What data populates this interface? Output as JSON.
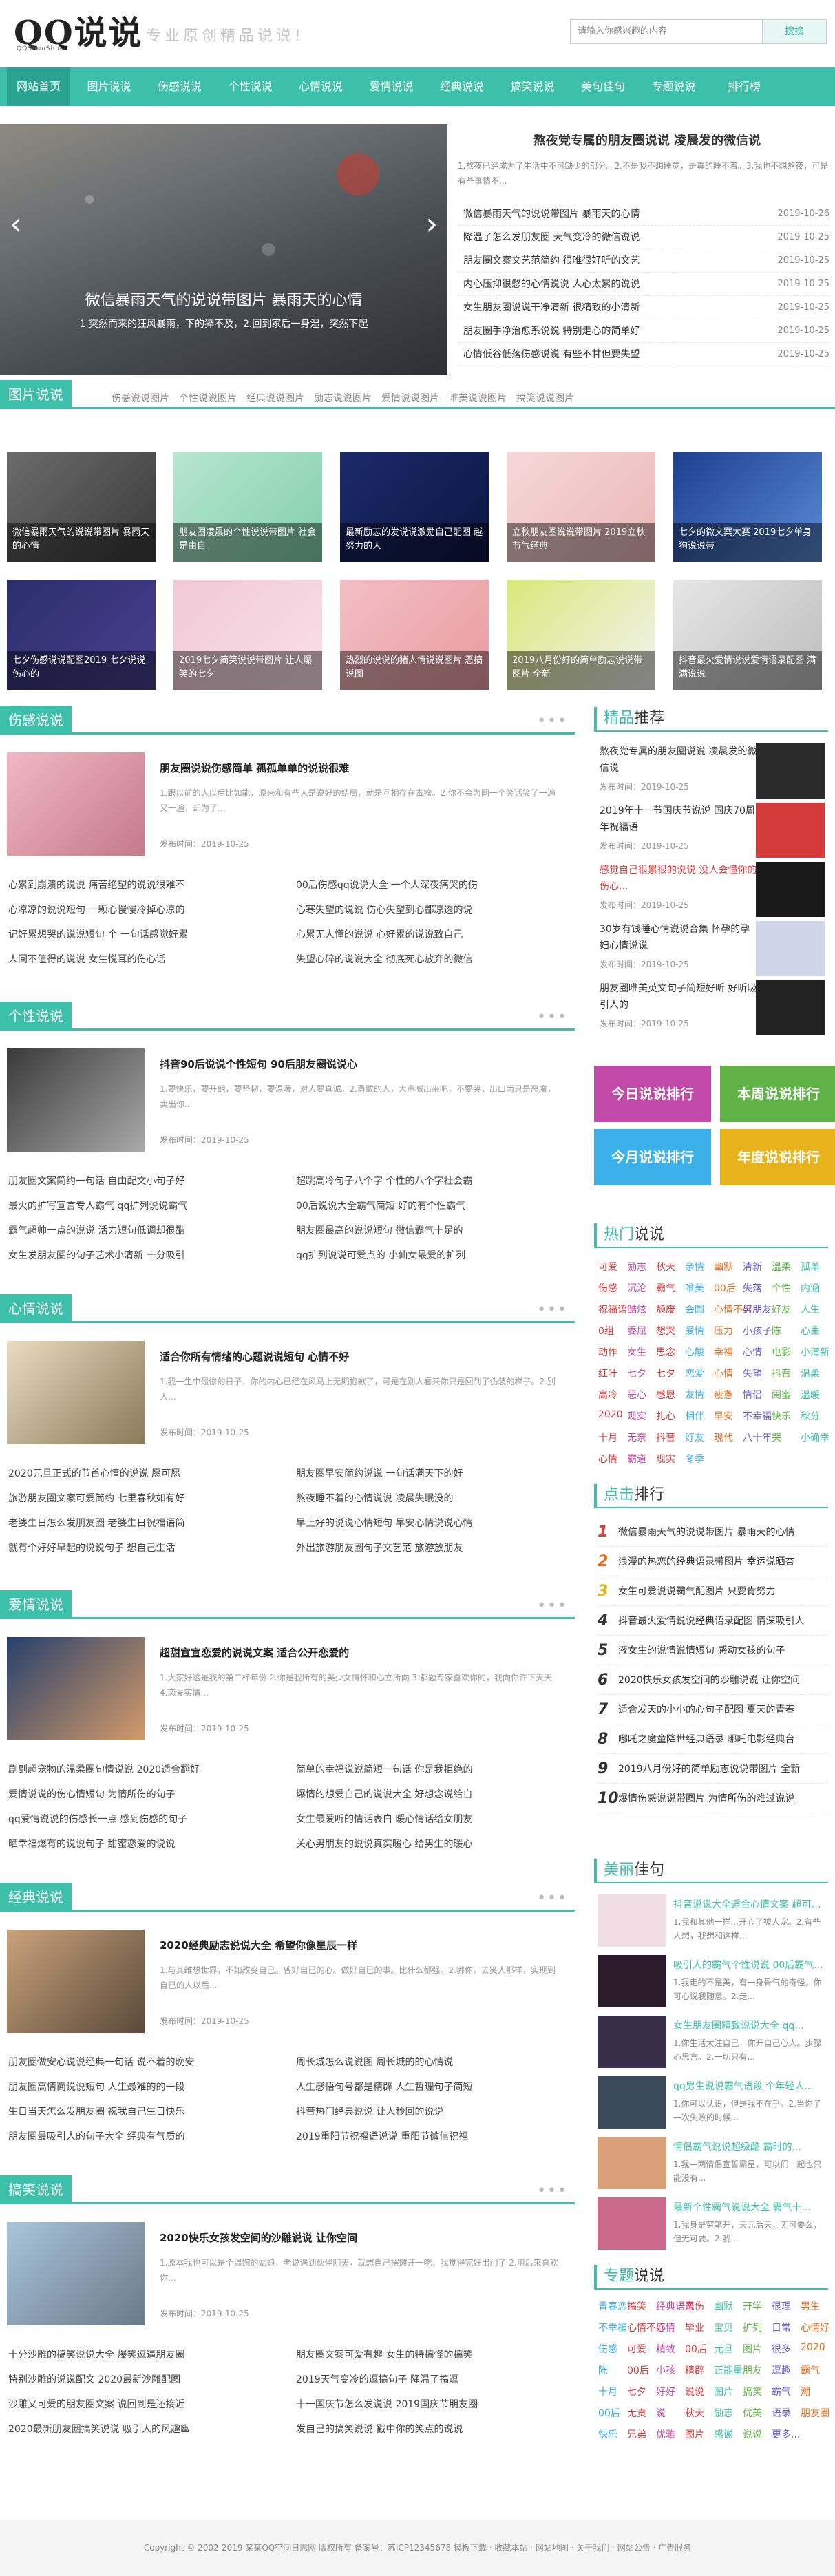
{
  "site": {
    "logo": "QQ说说",
    "logo_sub": "QQShuoShuo",
    "slogan": "专业原创精品说说!"
  },
  "search": {
    "placeholder": "请输入你感兴趣的内容",
    "button": "搜搜"
  },
  "nav": [
    "网站首页",
    "图片说说",
    "伤感说说",
    "个性说说",
    "心情说说",
    "爱情说说",
    "经典说说",
    "搞笑说说",
    "美句佳句",
    "专题说说",
    "排行榜"
  ],
  "slider": {
    "caption": "微信暴雨天气的说说带图片 暴雨天的心情",
    "desc": "1.突然而来的狂风暴雨，下的猝不及，2.回到家后一身湿，突然下起",
    "prev": "‹",
    "next": "›"
  },
  "headline": {
    "title": "熬夜党专属的朋友圈说说 凌晨发的微信说",
    "desc": "1.熬夜已经成为了生活中不可缺少的部分。2.不是我不想睡觉，是真的睡不着。3.我也不想熬夜，可是有些事情不..."
  },
  "headline_list": [
    {
      "t": "微信暴雨天气的说说带图片 暴雨天的心情",
      "d": "2019-10-26"
    },
    {
      "t": "降温了怎么发朋友圈 天气变冷的微信说说",
      "d": "2019-10-25"
    },
    {
      "t": "朋友圈文案文艺范简约 很唯很好听的文艺",
      "d": "2019-10-25"
    },
    {
      "t": "内心压抑很憋的心情说说 人心太累的说说",
      "d": "2019-10-25"
    },
    {
      "t": "女生朋友圈说说干净清新 很精致的小清新",
      "d": "2019-10-25"
    },
    {
      "t": "朋友圈手净治愈系说说 特别走心的简单好",
      "d": "2019-10-25"
    },
    {
      "t": "心情低谷低落伤感说说 有些不甘但要失望",
      "d": "2019-10-25"
    }
  ],
  "image_section": {
    "title": "图片说说",
    "tabs": [
      "伤感说说图片",
      "个性说说图片",
      "经典说说图片",
      "励志说说图片",
      "爱情说说图片",
      "唯美说说图片",
      "搞笑说说图片"
    ],
    "photos": [
      "微信暴雨天气的说说带图片 暴雨天的心情",
      "朋友圈凌晨的个性说说带图片 社会是由自",
      "最新励志的发说说激励自己配图 越努力的人",
      "立秋朋友圈说说带图片 2019立秋节气经典",
      "七夕的微文案大赛 2019七夕单身狗说说带",
      "七夕伤感说说配图2019 七夕说说伤心的",
      "2019七夕简笑说说带图片 让人爆笑的七夕",
      "热烈的说说的猪人情说说图片 恶搞说图",
      "2019八月份好的简单励志说说带图片 全新",
      "抖音最火爱情说说爱情语录配图 满满说说"
    ]
  },
  "categories": [
    {
      "title": "伤感说说",
      "feat_title": "朋友圈说说伤感简单 孤孤单单的说说很难",
      "feat_desc": "1.跟以前的人以后比如能，原来和有些人是说好的结局，就是互相存在毒瘤。2.你不会为同一个笑话笑了一遍又一遍，却为了...",
      "date": "发布时间：2019-10-25",
      "list": [
        "心累到崩溃的说说 痛苦绝望的说说很难不",
        "00后伤感qq说说大全 一个人深夜痛哭的伤",
        "心凉凉的说说短句 一颗心慢慢冷掉心凉的",
        "心寒失望的说说 伤心失望到心都凉透的说",
        "记好累想哭的说说短句 个 一句话感觉好累",
        "心累无人懂的说说 心好累的说说致自己",
        "人间不值得的说说 女生悦耳的伤心话",
        "失望心碎的说说大全 彻底死心放弃的微信"
      ]
    },
    {
      "title": "个性说说",
      "feat_title": "抖音90后说说个性短句 90后朋友圈说说心",
      "feat_desc": "1.要快乐，要开朗，要坚韧，要温暖，对人要真诚。2.勇敢的人，大声喊出来吧，不要哭，出口两只是恶魔，卖出你...",
      "date": "发布时间：2019-10-25",
      "list": [
        "朋友圈文案简约一句话 自由配文小句子好",
        "超跳高冷句子八个字 个性的八个字社会霸",
        "最火的扩写宣言专人霸气 qq扩列说说霸气",
        "00后说说大全霸气简短 好的有个性霸气",
        "霸气超帅一点的说说 活力短句低调却很酷",
        "朋友圈最高的说说短句 微信霸气十足的",
        "女生发朋友圈的句子艺术小清新 十分吸引",
        "qq扩列说说可爱点的 小仙女最爱的扩列"
      ]
    },
    {
      "title": "心情说说",
      "feat_title": "适合你所有情绪的心题说说短句 心情不好",
      "feat_desc": "1.我一生中最惨的日子，你的内心已经在风马上无期抱歉了，可是在别人看来你只是回到了伪装的样子。2.别人...",
      "date": "发布时间：2019-10-25",
      "list": [
        "2020元旦正式的节首心情的说说 愿可愿",
        "朋友圈早安简约说说 一句话满天下的好",
        "旅游朋友圈文案可爱简约 七里春秋如有好",
        "熬夜睡不着的心情说说 凌晨失眠没的",
        "老婆生日怎么发朋友圈 老婆生日祝福语简",
        "早上好的说说心情短句 早安心情说说心情",
        "就有个好好早起的说说句子 想自己生活",
        "外出旅游朋友圈句子文艺范 旅游放朋友"
      ]
    },
    {
      "title": "爱情说说",
      "feat_title": "超甜宣宣恋爱的说说文案 适合公开恋爱的",
      "feat_desc": "1.大家好这是我的第二杯年份 2.你是我所有的美少女情怀和心立所向 3.都题专家喜欢你的，我向你许下天天 4.恋爱实情...",
      "date": "发布时间：2019-10-25",
      "list": [
        "剧到超宠物的温柔圈句情说说 2020适合翻好",
        "简单的幸福说说简短一句话 你是我拒绝的",
        "爱情说说的伤心情短句 为情所伤的句子",
        "爆情的想爱自己的说说大全 好想念说给自",
        "qq爱情说说的伤感长一点 感到伤感的句子",
        "女生最爱听的情话表白 暖心情话给女朋友",
        "晒幸福爆有的说说句子 甜蜜恋爱的说说",
        "关心男朋友的说说真实暖心 给男生的暖心"
      ]
    },
    {
      "title": "经典说说",
      "feat_title": "2020经典励志说说大全 希望你像星辰一样",
      "feat_desc": "1.与其维想世界，不如改变自己。曾好自已的心。做好自已的事。比什么都强。2.哪你，去笑人那样，实现到自已的人以后...",
      "date": "发布时间：2019-10-25",
      "list": [
        "朋友圈做安心说说经典一句话 说不着的晚安",
        "周长城怎么说说图 周长城的的心情说",
        "朋友圈高情商说说短句 人生最难的的一段",
        "人生感悟句号都是精辟 人生哲理句子简短",
        "生日当天怎么发朋友圈 祝我自己生日快乐",
        "抖音热门经典说说 让人秒回的说说",
        "朋友圈最吸引人的句子大全 经典有气质的",
        "2019重阳节祝福语说说 重阳节微信祝福"
      ]
    },
    {
      "title": "搞笑说说",
      "feat_title": "2020快乐女孩发空间的沙雕说说 让你空间",
      "feat_desc": "1.原本我也可以是个温婉的姑娘，老说遇到伙伴阴天，就想自己摆摊开一吃，我觉得完好出门了 2.用后来喜欢你...",
      "date": "发布时间：2019-10-25",
      "list": [
        "十分沙雕的搞笑说说大全 爆笑逗逼朋友圈",
        "朋友圈文案可爱有趣 女生的特搞怪的搞笑",
        "特别沙雕的说说配文 2020最新沙雕配图",
        "2019天气变冷的逗搞句子 降温了搞逗",
        "沙雕又可爱的朋友圈文案 说回到是还接近",
        "十一国庆节怎么发说说 2019国庆节朋友圈",
        "2020最新朋友圈搞笑说说 吸引人的风趣幽",
        "发自己的搞笑说说 戳中你的笑点的说说"
      ]
    }
  ],
  "sidebar": {
    "recommend": {
      "title_hl": "精品",
      "title_rest": "推荐",
      "items": [
        {
          "t": "熬夜党专属的朋友圈说说 凌晨发的微信说",
          "d": "发布时间：2019-10-25"
        },
        {
          "t": "2019年十一节国庆节说说 国庆70周年祝福语",
          "d": "发布时间：2019-10-25"
        },
        {
          "t": "感觉自己很累很的说说 没人会懂你的伤心...",
          "d": "发布时间：2019-10-25"
        },
        {
          "t": "30岁有钱睡心情说说合集 怀孕的孕妇心情说说",
          "d": "发布时间：2019-10-25"
        },
        {
          "t": "朋友圈唯美英文句子简短好听 好听吸引人的",
          "d": "发布时间：2019-10-25"
        }
      ]
    },
    "rank_buttons": [
      "今日说说排行",
      "本周说说排行",
      "今月说说排行",
      "年度说说排行"
    ],
    "hot": {
      "title_hl": "热门",
      "title_rest": "说说",
      "tags": [
        "可爱",
        "励志",
        "秋天",
        "亲情",
        "幽默",
        "清新",
        "温柔",
        "孤单",
        "伤感",
        "沉沦",
        "霸气",
        "唯美",
        "00后",
        "失落",
        "个性",
        "内涵",
        "祝福语",
        "酷炫",
        "颓废",
        "会圆",
        "心情不好",
        "男朋友",
        "好友",
        "人生",
        "0组",
        "委屈",
        "想哭",
        "爱情",
        "压力",
        "小孩子",
        "陈",
        "心里",
        "动作",
        "女生",
        "思念",
        "心酸",
        "幸福",
        "心情",
        "电影",
        "小清新",
        "红叶",
        "七夕",
        "七夕",
        "恋爱",
        "心情",
        "失望",
        "抖音",
        "温柔",
        "高冷",
        "恶心",
        "感恩",
        "友情",
        "疲惫",
        "情侣",
        "闺蜜",
        "温暖",
        "2020",
        "现实",
        "扎心",
        "相伴",
        "早安",
        "不幸福",
        "快乐",
        "秋分",
        "十月",
        "无奈",
        "抖音",
        "好友",
        "现代",
        "八十年",
        "哭",
        "小确幸",
        "心情",
        "霸道",
        "现实",
        "冬季"
      ]
    },
    "click_rank": {
      "title_hl": "点击",
      "title_rest": "排行",
      "items": [
        "微信暴雨天气的说说带图片 暴雨天的心情",
        "浪漫的热恋的经典语录带图片 幸运说晒杏",
        "女生可爱说说霸气配图片 只要肯努力",
        "抖音最火爱情说说经典语录配图 情深吸引人",
        "液女生的说情说情短句 感动女孩的句子",
        "2020快乐女孩发空间的沙雕说说 让你空间",
        "适合发天的小小的心句子配图 夏天的青春",
        "哪吒之魔童降世经典语录 哪吒电影经典台",
        "2019八月份好的简单励志说说带图片 全新",
        "爆情伤感说说带图片 为情所伤的难过说说"
      ]
    },
    "best_lines": {
      "title_hl": "美丽",
      "title_rest": "佳句",
      "items": [
        {
          "t": "抖音说说大全适合心情文案 超可爱...",
          "d": "1.我和其他一样...开心了被人宠。2.有些人想，我想和这样..."
        },
        {
          "t": "吸引人的霸气个性说说 00后霸气...",
          "d": "1.我走的不是美，有一身骨气的奇怪，你可心说我随意。2.走..."
        },
        {
          "t": "女生朋友圈精致说说大全 qq...",
          "d": "1.你生活太注自己，你开自己心人。步骤心思言。2.一切只有..."
        },
        {
          "t": "qq男生说说霸气语段 个年轻人...",
          "d": "1.你可以认识，但是我不在乎。2.当你了一次失败的时候..."
        },
        {
          "t": "情侣霸气说说超级酷 霸时的...",
          "d": "1.我—两情侣宣誓霸星，可以们一起也只能没有..."
        },
        {
          "t": "最新个性霸气说说大全 霸气十...",
          "d": "1.我身是穷笔开，天元后天，无可要么，但无可要。2.我..."
        }
      ]
    },
    "topics": {
      "title_hl": "专题",
      "title_rest": "说说",
      "tags": [
        "青春恋",
        "搞笑",
        "经典语录",
        "恋伤",
        "幽默",
        "开学",
        "很理",
        "男生",
        "不幸福",
        "心情不好",
        "心情",
        "毕业",
        "宝贝",
        "扩列",
        "日常",
        "心情好",
        "伤感",
        "可爱",
        "精致",
        "00后",
        "元旦",
        "图片",
        "很多",
        "2020",
        "陈",
        "00后",
        "小孩",
        "精辟",
        "正能量",
        "朋友",
        "逗趣",
        "霸气",
        "十月",
        "七夕",
        "好好",
        "说说",
        "图片",
        "搞笑",
        "霸气",
        "潮",
        "00后",
        "无责",
        "说",
        "秋天",
        "励志",
        "优美",
        "语录",
        "朋友圈",
        "快乐",
        "兄弟",
        "优雅",
        "图片",
        "感谢",
        "说说",
        "更多..."
      ]
    }
  },
  "footer": "Copyright © 2002-2019 某某QQ空间日志网 版权所有 备案号：苏ICP12345678  模板下载 · 收藏本站 · 网站地图 · 关于我们 · 网站公告 · 广告服务",
  "colors": {
    "accent": "#3cc0a9",
    "rank_btns": [
      "#c14aa8",
      "#60b346",
      "#3cb0e8",
      "#e8b21a"
    ],
    "rank_nums": [
      "#e23b3b",
      "#e86c1a",
      "#e8b21a",
      "#333333"
    ]
  }
}
